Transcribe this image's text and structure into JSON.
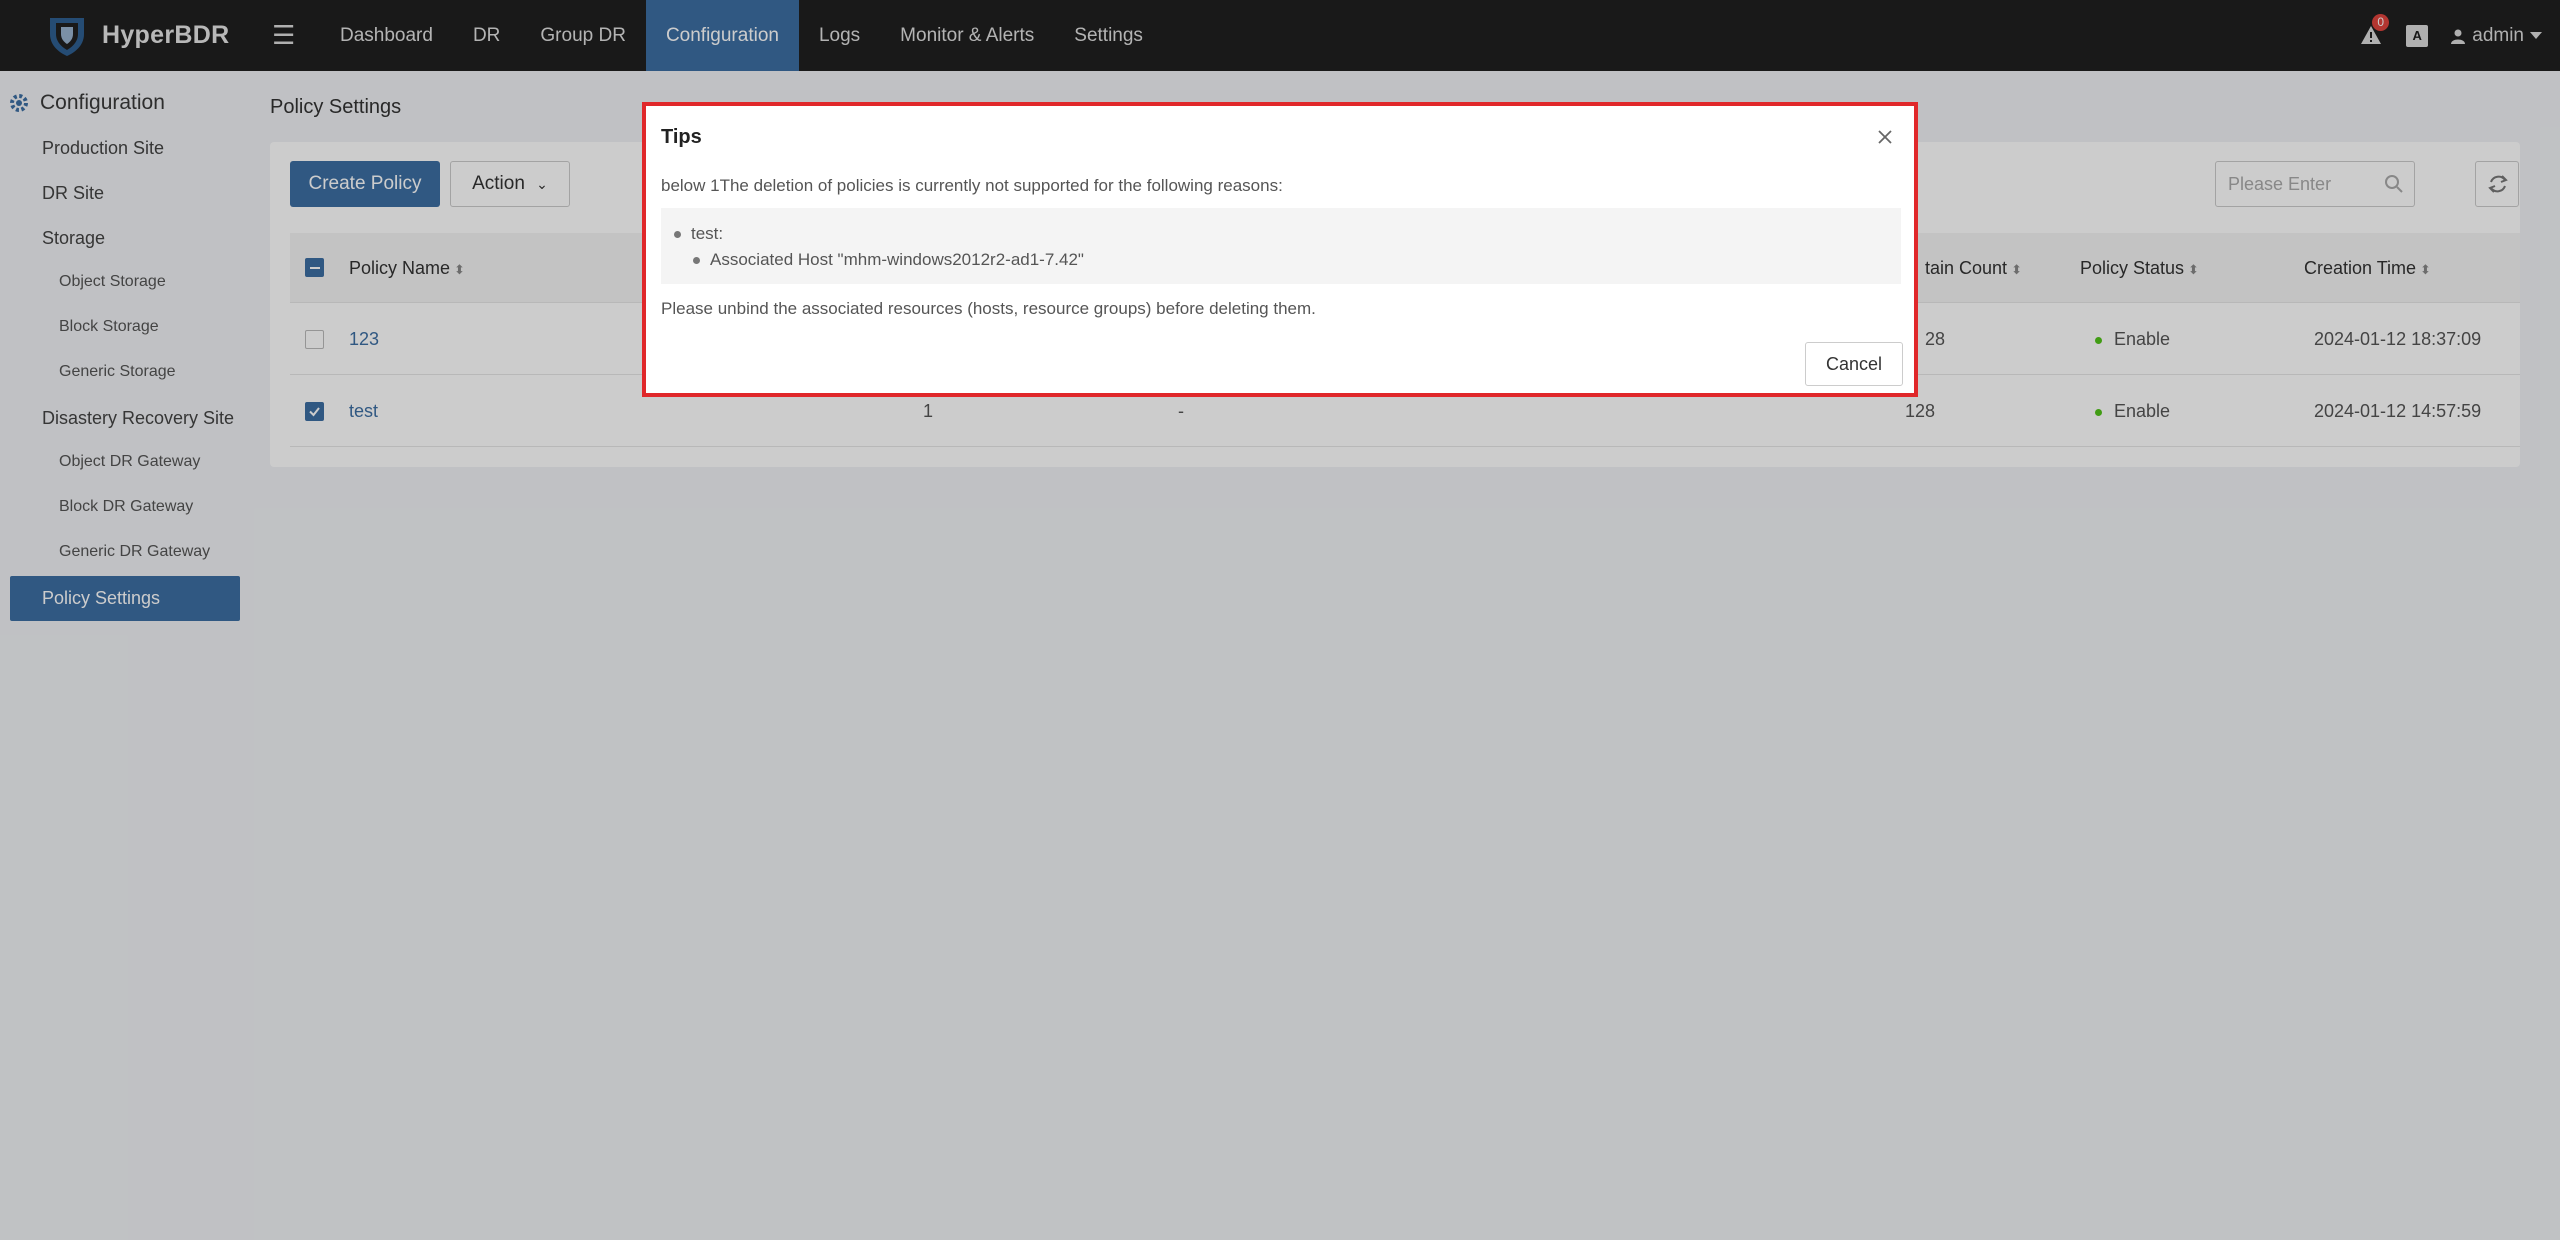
{
  "app": {
    "name": "HyperBDR"
  },
  "nav": {
    "items": [
      "Dashboard",
      "DR",
      "Group DR",
      "Configuration",
      "Logs",
      "Monitor & Alerts",
      "Settings"
    ],
    "active": "Configuration"
  },
  "top_right": {
    "alert_count": "0",
    "lang_icon": "A",
    "user": "admin"
  },
  "sidebar": {
    "title": "Configuration",
    "items": {
      "production_site": "Production Site",
      "dr_site": "DR Site",
      "storage": "Storage",
      "object_storage": "Object Storage",
      "block_storage": "Block Storage",
      "generic_storage": "Generic Storage",
      "disaster_recovery_site": "Disastery Recovery Site",
      "object_dr_gateway": "Object DR Gateway",
      "block_dr_gateway": "Block DR Gateway",
      "generic_dr_gateway": "Generic DR Gateway",
      "policy_settings": "Policy Settings"
    }
  },
  "main": {
    "title": "Policy Settings",
    "create_button": "Create Policy",
    "action_button": "Action",
    "search_placeholder": "Please Enter",
    "columns": {
      "policy_name": "Policy Name",
      "retain_count": "tain Count",
      "policy_status": "Policy Status",
      "creation_time": "Creation Time"
    },
    "rows": [
      {
        "name": "123",
        "col2": "",
        "col3": "",
        "retain": "28",
        "status": "Enable",
        "time": "2024-01-12 18:37:09",
        "checked": false
      },
      {
        "name": "test",
        "col2": "1",
        "col3": "-",
        "retain": "128",
        "status": "Enable",
        "time": "2024-01-12 14:57:59",
        "checked": true
      }
    ]
  },
  "modal": {
    "title": "Tips",
    "message": "below 1The deletion of policies is currently not supported for the following reasons:",
    "reason_policy": "test:",
    "reason_detail": "Associated Host \"mhm-windows2012r2-ad1-7.42\"",
    "footer": "Please unbind the associated resources (hosts, resource groups) before deleting them.",
    "cancel": "Cancel"
  },
  "colors": {
    "accent": "#3d6ea3",
    "highlight": "#e0272a",
    "status_ok": "#52c41a"
  }
}
